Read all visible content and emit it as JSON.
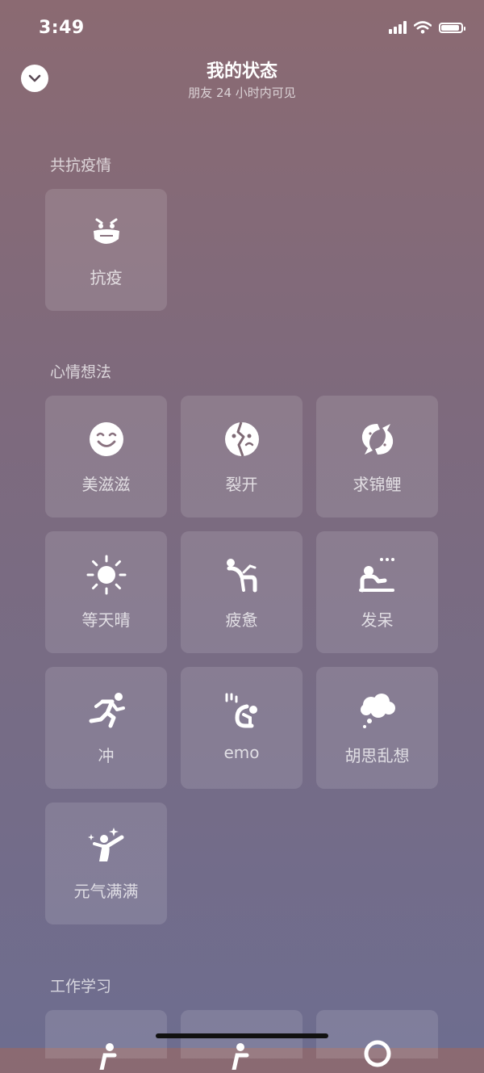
{
  "status_bar": {
    "time": "3:49",
    "battery_level": 0.9
  },
  "header": {
    "title": "我的状态",
    "subtitle": "朋友 24 小时内可见"
  },
  "sections": {
    "covid": {
      "title": "共抗疫情",
      "items": [
        {
          "label": "抗疫",
          "icon": "mask-face-icon"
        }
      ]
    },
    "mood": {
      "title": "心情想法",
      "items": [
        {
          "label": "美滋滋",
          "icon": "smile-face-icon"
        },
        {
          "label": "裂开",
          "icon": "cracked-face-icon"
        },
        {
          "label": "求锦鲤",
          "icon": "koi-fish-icon"
        },
        {
          "label": "等天晴",
          "icon": "sun-icon"
        },
        {
          "label": "疲惫",
          "icon": "slumped-person-icon"
        },
        {
          "label": "发呆",
          "icon": "daydream-person-icon"
        },
        {
          "label": "冲",
          "icon": "running-person-icon"
        },
        {
          "label": "emo",
          "icon": "crouching-person-icon"
        },
        {
          "label": "胡思乱想",
          "icon": "thought-cloud-icon"
        },
        {
          "label": "元气满满",
          "icon": "energetic-person-icon"
        }
      ]
    },
    "work": {
      "title": "工作学习"
    }
  }
}
